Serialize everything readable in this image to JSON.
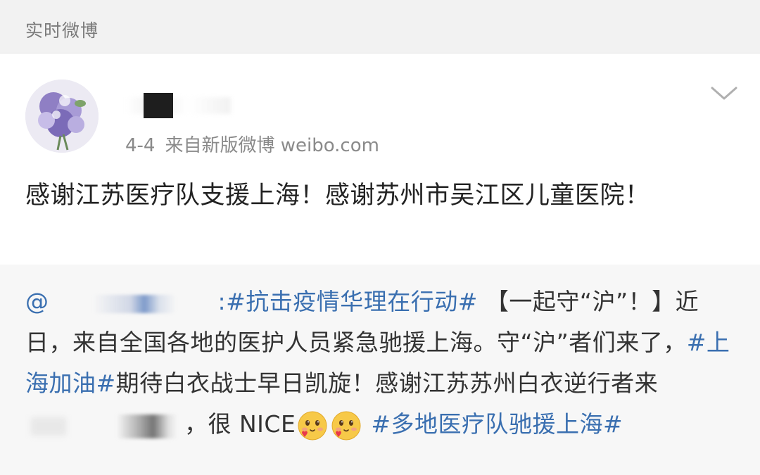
{
  "section": {
    "title": "实时微博"
  },
  "post": {
    "username": "",
    "time": "4-4",
    "source": "来自新版微博 weibo.com",
    "text": "感谢江苏医疗队支援上海！感谢苏州市吴江区儿童医院！"
  },
  "repost": {
    "at": "@",
    "colon_topic": ":#抗击疫情华理在行动#",
    "part1": " 【一起守“沪”！】近日，来自全国各地的医护人员紧急驰援上海。守“沪”者们来了，",
    "topic2": "#上海加油#",
    "part2": "期待白衣战士早日凯旋！感谢江苏苏州白衣逆行者来",
    "part3": "，很 NICE",
    "topic3": "#多地医疗队驰援上海#",
    "emoji_name": "love-face-emoji"
  },
  "colors": {
    "link": "#3a6fb0",
    "header_bg": "#f2f2f2",
    "repost_bg": "#f7f7f7"
  }
}
